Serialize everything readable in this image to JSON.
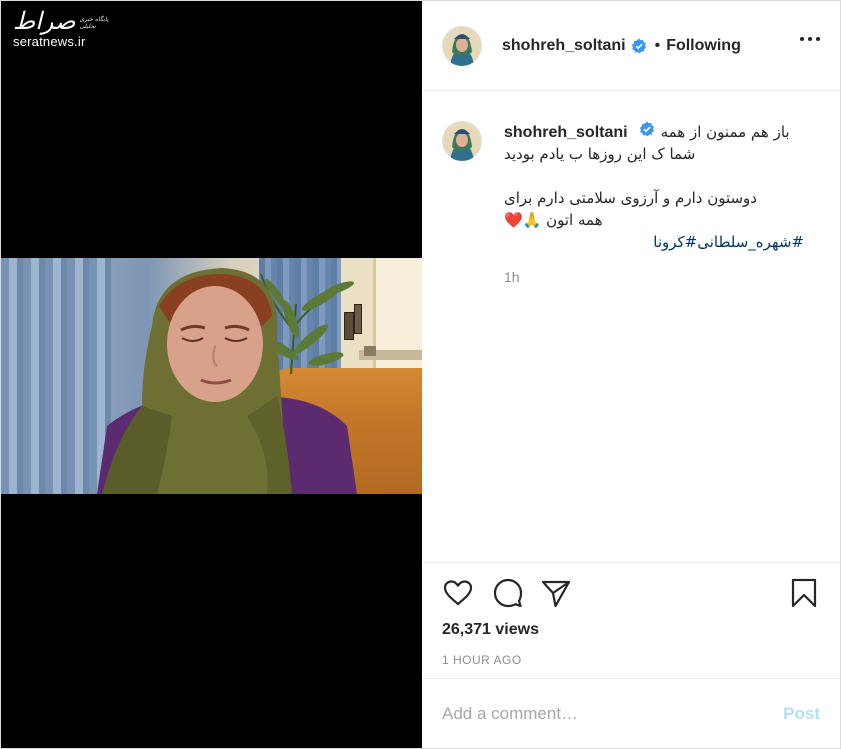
{
  "watermark": {
    "logo": "صراط",
    "subtitle": "پایگاه خبری تحلیلی",
    "url": "seratnews.ir"
  },
  "header": {
    "username": "shohreh_soltani",
    "separator": "•",
    "follow_status": "Following",
    "more_icon": "more-horizontal-icon"
  },
  "caption": {
    "username": "shohreh_soltani",
    "line1": "باز هم ممنون از همه",
    "line2": "شما ک این روزها ب یادم بودید",
    "line3": "دوستون دارم و آرزوی سلامتی دارم برای",
    "line4": "همه اتون 🙏❤️",
    "hashtags": "#شهره_سلطانی#کرونا",
    "time": "1h"
  },
  "actions": {
    "like_icon": "heart-icon",
    "comment_icon": "comment-icon",
    "share_icon": "paper-plane-icon",
    "save_icon": "bookmark-icon",
    "views": "26,371 views",
    "timestamp": "1 HOUR AGO"
  },
  "comment_form": {
    "placeholder": "Add a comment…",
    "post_label": "Post"
  },
  "colors": {
    "verified": "#3897f0",
    "hashtag": "#00376b",
    "post_disabled": "#b2dffc",
    "muted": "#8e8e8e"
  }
}
